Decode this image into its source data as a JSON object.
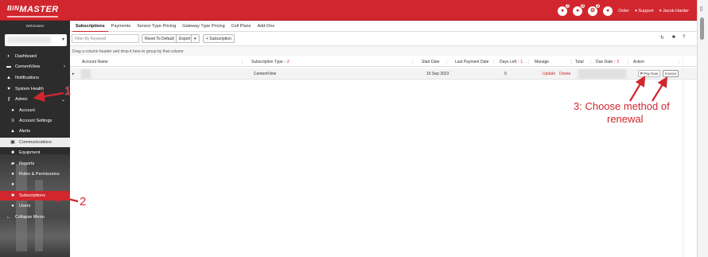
{
  "topbar": {
    "logo_text": "BINMASTER",
    "logo_prefix": "BIN",
    "logo_suffix": "MASTER",
    "icons": [
      {
        "name": "notification-icon",
        "glyph": "●",
        "badge": "3"
      },
      {
        "name": "alert-icon",
        "glyph": "●",
        "badge": "9"
      },
      {
        "name": "settings-icon",
        "glyph": "⚙",
        "badge": "3"
      },
      {
        "name": "cart-icon",
        "glyph": "●",
        "badge": ""
      }
    ],
    "order_label": "Order",
    "support_label": "▾ Support",
    "user_label": "▾ Jacob Harder"
  },
  "sidebar": {
    "username": "Webmaster",
    "account_select_value": "",
    "items": [
      {
        "label": "Dashboard",
        "icon": "dashboard-icon",
        "glyph": "◐"
      },
      {
        "label": "CementView",
        "icon": "cementview-icon",
        "glyph": "▬",
        "arrow": "›"
      },
      {
        "label": "Notifications",
        "icon": "bell-icon",
        "glyph": "▲"
      },
      {
        "label": "System Health",
        "icon": "heart-icon",
        "glyph": "♥"
      },
      {
        "label": "Admin",
        "icon": "key-icon",
        "glyph": "⚷",
        "arrow": "⌄"
      },
      {
        "label": "Account",
        "icon": "info-icon",
        "glyph": "●"
      },
      {
        "label": "Account Settings",
        "icon": "sliders-icon",
        "glyph": "≡"
      },
      {
        "label": "Alerts",
        "icon": "warning-icon",
        "glyph": "▲"
      },
      {
        "label": "Communications",
        "icon": "inbox-icon",
        "glyph": "▣"
      },
      {
        "label": "Equipment",
        "icon": "equipment-icon",
        "glyph": "■"
      },
      {
        "label": "Reports",
        "icon": "reports-icon",
        "glyph": "▰"
      },
      {
        "label": "Roles & Permissions",
        "icon": "lock-icon",
        "glyph": "●"
      },
      {
        "label": "",
        "icon": "pin-icon",
        "glyph": "●"
      },
      {
        "label": "Subscriptions",
        "icon": "document-icon",
        "glyph": "■"
      },
      {
        "label": "Users",
        "icon": "users-icon",
        "glyph": "●"
      },
      {
        "label": "Collapse Menu",
        "icon": "collapse-icon",
        "glyph": "←"
      }
    ]
  },
  "tabs": [
    "Subscriptions",
    "Payments",
    "Sensor Type Pricing",
    "Gateway Type Pricing",
    "Cell Plans",
    "Add-Ons"
  ],
  "toolbar": {
    "search_placeholder": "Filter By Keyword",
    "reset_label": "Reset To Default",
    "export_label": "Export",
    "export_caret": "▾",
    "add_label": "+ Subscription",
    "refresh_glyph": "↻",
    "pdf_glyph": "■",
    "help_glyph": "?"
  },
  "group_hint": "Drag a column header and drop it here to group by that column",
  "grid": {
    "columns": [
      {
        "label": "Account Name",
        "sort": ""
      },
      {
        "label": "Subscription Type",
        "sort": "↑ 2"
      },
      {
        "label": "Start Date",
        "sort": ""
      },
      {
        "label": "Last Payment Date",
        "sort": ""
      },
      {
        "label": "Days Left",
        "sort": "↑ 1"
      },
      {
        "label": "Manage",
        "sort": ""
      },
      {
        "label": "Total",
        "sort": ""
      },
      {
        "label": "Due Date",
        "sort": "↑ 3"
      },
      {
        "label": "Action",
        "sort": ""
      }
    ],
    "rows": [
      {
        "expander": "▸",
        "account_name": "",
        "subscription_type": "CementView",
        "start_date": "15 Sep 2023",
        "last_payment_date": "",
        "days_left": "0",
        "manage_update": "Update",
        "manage_delete": "Delete",
        "total": "",
        "due_date": "",
        "pay_now": "₱ Pay Now",
        "invoice": "Invoice"
      }
    ]
  },
  "annotations": {
    "step1": "1",
    "step2": "2",
    "step3_line1": "3: Choose method of",
    "step3_line2": "renewal"
  },
  "colors": {
    "brand_red": "#d2262e",
    "sidebar_bg": "#2c2c2c"
  }
}
